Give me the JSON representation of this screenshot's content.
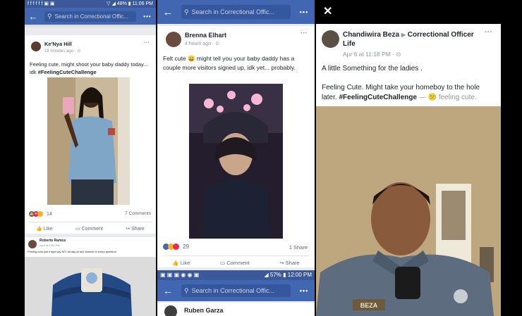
{
  "panel1": {
    "status": {
      "left": "f f f f f f ▣ ▣",
      "right": "▽ ◢ 48% ▮ 11:06 PM"
    },
    "search_placeholder": "Search in Correctional Offic...",
    "post": {
      "name": "Ke'Nya Hill",
      "time": "18 minutes ago · ⊙",
      "text": "Feeling cute, might shoot your baby daddy today... idk",
      "hashtag": "#FeelingCuteChallenge",
      "reaction_count": "14",
      "comments": "7 Comments",
      "actions": [
        "Like",
        "Comment",
        "Share"
      ]
    },
    "post2": {
      "name": "Roberto Ramos",
      "time": "April at 8:50 PM",
      "text": "Feeling cute just might say NO! all day at any answer to every question"
    }
  },
  "panel2": {
    "search_placeholder": "Search in Correctional Offic...",
    "post": {
      "name": "Brenna Elhart",
      "time": "4 hours ago · ⊙",
      "text": "Felt cute 😄 might tell you your baby daddy has a couple more visitors signed up, idk yet... probably.",
      "reaction_count": "29",
      "shares": "1 Share",
      "actions": [
        "Like",
        "Comment",
        "Share"
      ]
    },
    "status2": {
      "left": "▣ ▣ ▣ ◉ ◉ ▣",
      "right": "◢ 57% ▮ 12:00 PM"
    },
    "search_placeholder2": "Search in Correctional Offic...",
    "next_name": "Ruben Garza"
  },
  "panel3": {
    "close": "✕",
    "author": "Chandiwira Beza",
    "arrow": "▶",
    "group": "Correctional Officer Life",
    "time": "Apr 6 at 11:18 PM · ⊙",
    "line1": "A little Something for the ladies .",
    "line2": "Feeling Cute.  Might take your homeboy to the hole later.",
    "hashtag": "#FeelingCuteChallenge",
    "feeling": " — 😕 feeling cute.",
    "badge": "BEZA"
  },
  "colors": {
    "facebook_blue": "#4267b2",
    "status_blue": "#3b5998"
  }
}
